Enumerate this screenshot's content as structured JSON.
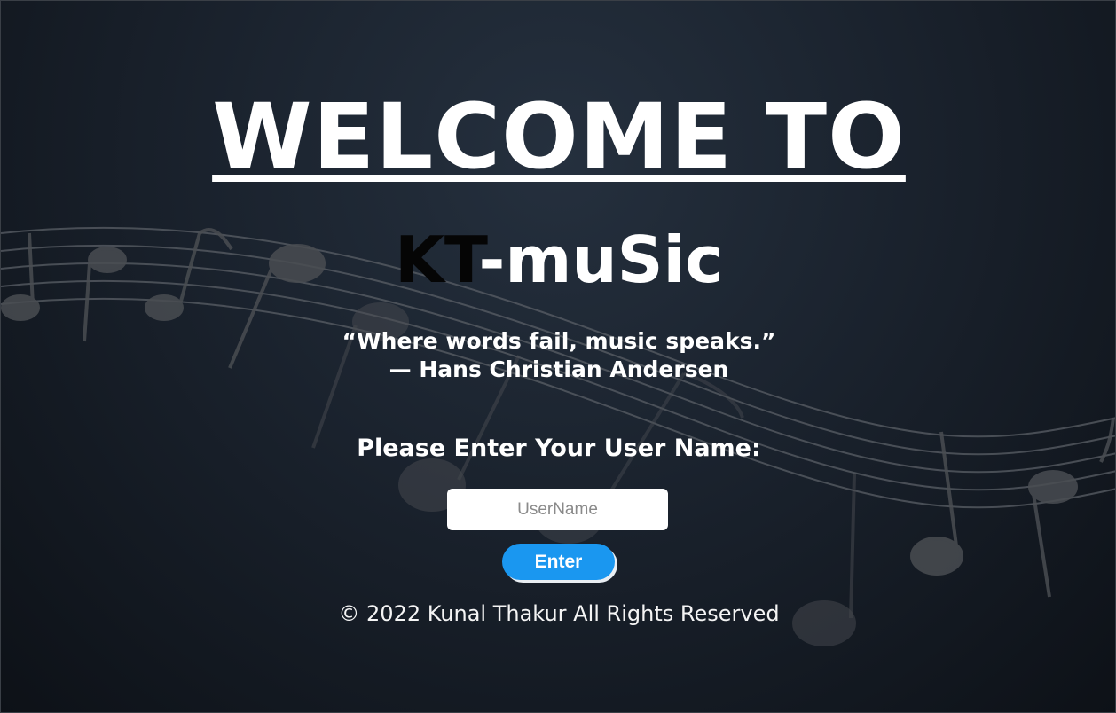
{
  "heading": {
    "welcome": "WELCOME TO",
    "brand_part1": "KT",
    "brand_part2": "-muSic"
  },
  "quote": {
    "text": "“Where words fail, music speaks.”",
    "author": "— Hans Christian Andersen"
  },
  "form": {
    "prompt": "Please Enter Your User Name:",
    "username_placeholder": "UserName",
    "username_value": "",
    "enter_label": "Enter"
  },
  "footer": {
    "copyright": "© 2022 Kunal Thakur All Rights Reserved"
  },
  "colors": {
    "button": "#1a97f0",
    "brand_dark": "#050505",
    "text": "#ffffff"
  },
  "icons": {
    "background": "music-notes-staff-icon"
  }
}
